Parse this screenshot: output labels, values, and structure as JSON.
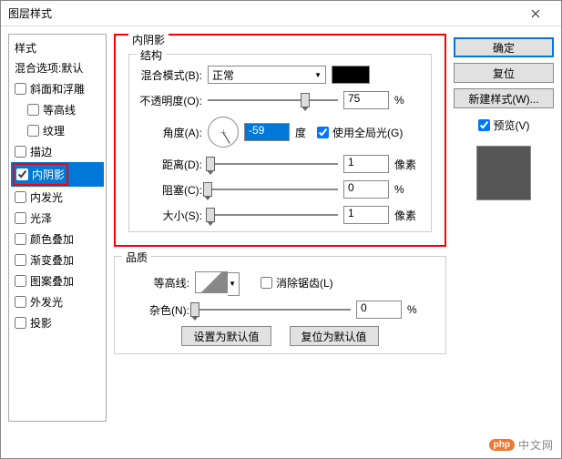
{
  "window": {
    "title": "图层样式"
  },
  "left": {
    "title": "样式",
    "blend_default": "混合选项:默认",
    "items": [
      {
        "label": "斜面和浮雕",
        "checked": false
      },
      {
        "label": "等高线",
        "checked": false,
        "sub": true
      },
      {
        "label": "纹理",
        "checked": false,
        "sub": true
      },
      {
        "label": "描边",
        "checked": false
      },
      {
        "label": "内阴影",
        "checked": true,
        "selected": true
      },
      {
        "label": "内发光",
        "checked": false
      },
      {
        "label": "光泽",
        "checked": false
      },
      {
        "label": "颜色叠加",
        "checked": false
      },
      {
        "label": "渐变叠加",
        "checked": false
      },
      {
        "label": "图案叠加",
        "checked": false
      },
      {
        "label": "外发光",
        "checked": false
      },
      {
        "label": "投影",
        "checked": false
      }
    ]
  },
  "center": {
    "group_title": "内阴影",
    "structure_title": "结构",
    "blend_mode_label": "混合模式(B):",
    "blend_mode_value": "正常",
    "opacity_label": "不透明度(O):",
    "opacity_value": "75",
    "opacity_unit": "%",
    "angle_label": "角度(A):",
    "angle_value": "-59",
    "angle_unit": "度",
    "global_light_label": "使用全局光(G)",
    "global_light_checked": true,
    "distance_label": "距离(D):",
    "distance_value": "1",
    "distance_unit": "像素",
    "choke_label": "阻塞(C):",
    "choke_value": "0",
    "choke_unit": "%",
    "size_label": "大小(S):",
    "size_value": "1",
    "size_unit": "像素",
    "quality_title": "品质",
    "contour_label": "等高线:",
    "antialias_label": "消除锯齿(L)",
    "antialias_checked": false,
    "noise_label": "杂色(N):",
    "noise_value": "0",
    "noise_unit": "%",
    "set_default_btn": "设置为默认值",
    "reset_default_btn": "复位为默认值"
  },
  "right": {
    "ok": "确定",
    "reset": "复位",
    "new_style": "新建样式(W)...",
    "preview_label": "预览(V)",
    "preview_checked": true
  },
  "watermark": {
    "badge": "php",
    "text": "中文网"
  }
}
